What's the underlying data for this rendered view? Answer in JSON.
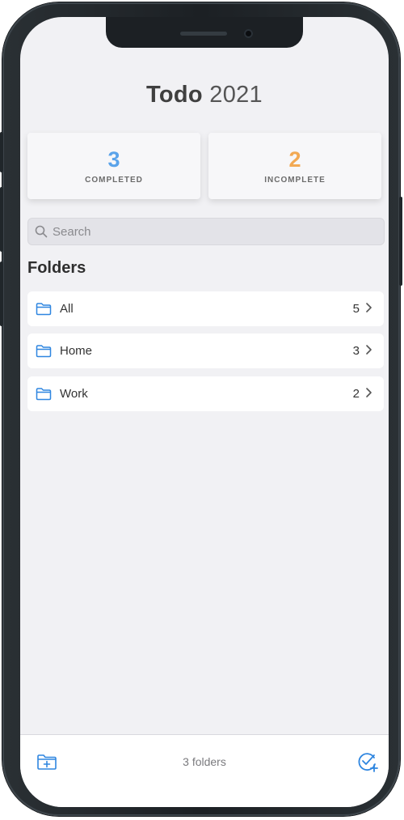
{
  "app": {
    "title_bold": "Todo",
    "title_light": "2021"
  },
  "stats": {
    "completed": {
      "value": "3",
      "label": "COMPLETED",
      "color": "#5aa3ea"
    },
    "incomplete": {
      "value": "2",
      "label": "INCOMPLETE",
      "color": "#f2a953"
    }
  },
  "search": {
    "placeholder": "Search",
    "value": "",
    "icon": "search-icon"
  },
  "folders": {
    "heading": "Folders",
    "items": [
      {
        "name": "All",
        "count": "5",
        "icon": "folder-icon"
      },
      {
        "name": "Home",
        "count": "3",
        "icon": "folder-icon"
      },
      {
        "name": "Work",
        "count": "2",
        "icon": "folder-icon"
      }
    ]
  },
  "toolbar": {
    "status": "3 folders",
    "left_icon": "new-folder-icon",
    "right_icon": "new-todo-icon",
    "accent": "#2f86e0"
  }
}
